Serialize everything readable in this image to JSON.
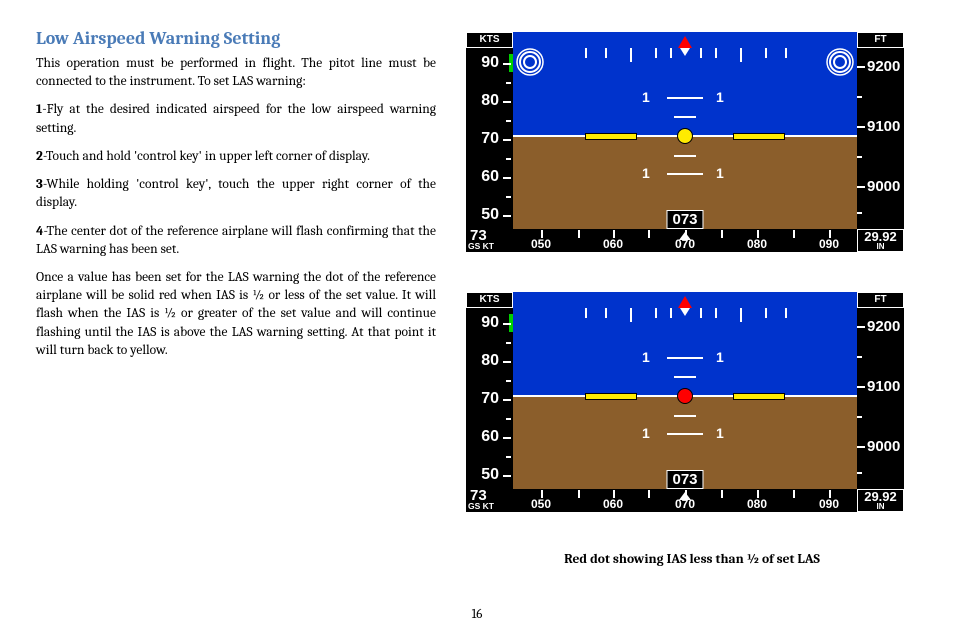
{
  "heading": "Low Airspeed Warning Setting",
  "intro": "This operation must be performed in flight.  The pitot line must be connected to the instrument.  To set LAS warning:",
  "steps": [
    {
      "n": "1",
      "t": "-Fly at the desired indicated airspeed for the low airspeed warning setting."
    },
    {
      "n": "2",
      "t": "-Touch and hold 'control key' in upper left corner of display."
    },
    {
      "n": "3",
      "t": "-While holding 'control key', touch the upper right corner of the display."
    },
    {
      "n": "4",
      "t": "-The center dot of the reference airplane will flash confirming that the LAS warning has been set."
    }
  ],
  "explain": "Once a value has been set for the LAS warning the dot of the reference airplane will be solid red when IAS is ½ or less of the set value.  It will flash when the IAS is ½ or greater of the set value and will continue flashing until the IAS is above the LAS warning setting.  At that point it will turn back to yellow.",
  "figCaption": "Red dot showing IAS less than ½ of set LAS",
  "pageNumber": "16",
  "pfd": {
    "ktsLabel": "KTS",
    "ftLabel": "FT",
    "spdTicks": [
      "90",
      "80",
      "70",
      "60",
      "50"
    ],
    "gsVal": "73",
    "gsLabel": "GS  KT",
    "altTicks": [
      "9200",
      "9100",
      "9000"
    ],
    "baroVal": "29.92",
    "baroUnit": "IN",
    "heading": "073",
    "hdgTicks": [
      "050",
      "060",
      "070",
      "080",
      "090"
    ],
    "pitchLabel": "1"
  }
}
